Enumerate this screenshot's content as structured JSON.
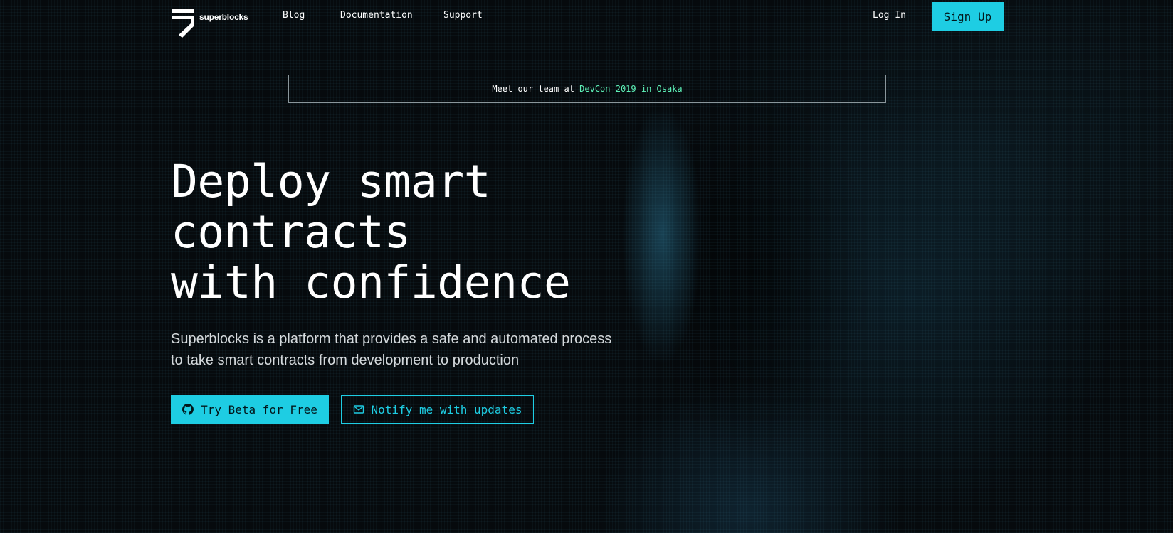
{
  "brand": {
    "name": "superblocks",
    "logo_icon": "superblocks-logo-mark"
  },
  "nav": {
    "links": [
      {
        "label": "Blog"
      },
      {
        "label": "Documentation"
      },
      {
        "label": "Support"
      }
    ],
    "login_label": "Log In",
    "signup_label": "Sign Up"
  },
  "announcement": {
    "prefix": "Meet our team at ",
    "highlight": "DevCon 2019 in Osaka"
  },
  "hero": {
    "title_lines": [
      "Deploy smart",
      "contracts",
      "with confidence"
    ],
    "subtitle_lines": [
      "Superblocks is a platform that provides a safe and automated process",
      "to take smart contracts from development to production"
    ],
    "primary_cta": {
      "label": "Try Beta for Free",
      "icon": "github-icon"
    },
    "secondary_cta": {
      "label": "Notify me with updates",
      "icon": "envelope-icon"
    }
  },
  "colors": {
    "accent": "#1ecde3",
    "highlight": "#5ef2b8",
    "background": "#05090c"
  }
}
